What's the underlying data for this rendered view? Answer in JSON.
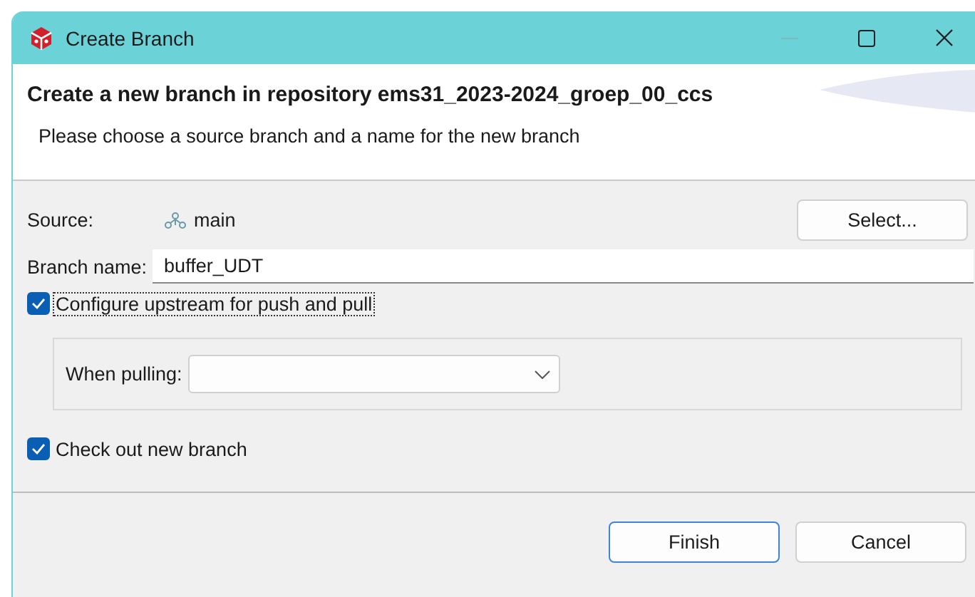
{
  "window": {
    "title": "Create Branch"
  },
  "header": {
    "title": "Create a new branch in repository ems31_2023-2024_groep_00_ccs",
    "message": "Please choose a source branch and a name for the new branch"
  },
  "source": {
    "label": "Source:",
    "value": "main",
    "button": "Select..."
  },
  "branch_name": {
    "label": "Branch name:",
    "value": "buffer_UDT"
  },
  "configure_upstream": {
    "label": "Configure upstream for push and pull",
    "checked": true,
    "focused": true
  },
  "when_pulling": {
    "label": "When pulling:"
  },
  "checkout": {
    "label": "Check out new branch",
    "checked": true
  },
  "buttons": [
    {
      "label": "Finish",
      "default": true
    },
    {
      "label": "Cancel",
      "default": false
    }
  ]
}
